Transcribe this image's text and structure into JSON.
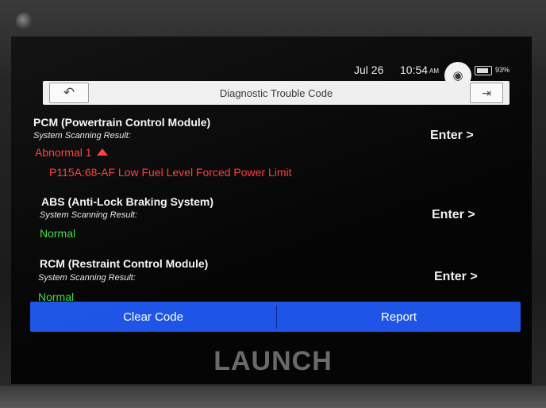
{
  "status": {
    "date": "Jul 26",
    "time": "10:54",
    "ampm": "AM",
    "battery": "93%"
  },
  "titlebar": {
    "title": "Diagnostic Trouble Code",
    "back_glyph": "↶",
    "exit_glyph": "⇥",
    "camera_glyph": "◉"
  },
  "modules": [
    {
      "name": "PCM (Powertrain Control Module)",
      "label": "System Scanning Result:",
      "status": "Abnormal 1",
      "dtc": "P115A:68-AF Low Fuel Level Forced Power Limit",
      "enter": "Enter >"
    },
    {
      "name": "ABS (Anti-Lock Braking System)",
      "label": "System Scanning Result:",
      "status": "Normal",
      "enter": "Enter >"
    },
    {
      "name": "RCM (Restraint Control Module)",
      "label": "System Scanning Result:",
      "status": "Normal",
      "enter": "Enter >"
    }
  ],
  "buttons": {
    "clear": "Clear Code",
    "report": "Report"
  },
  "brand": "LAUNCH",
  "colors": {
    "accent": "#1e55e6",
    "normal": "#3fdc3f",
    "abnormal": "#ff3b3b"
  }
}
